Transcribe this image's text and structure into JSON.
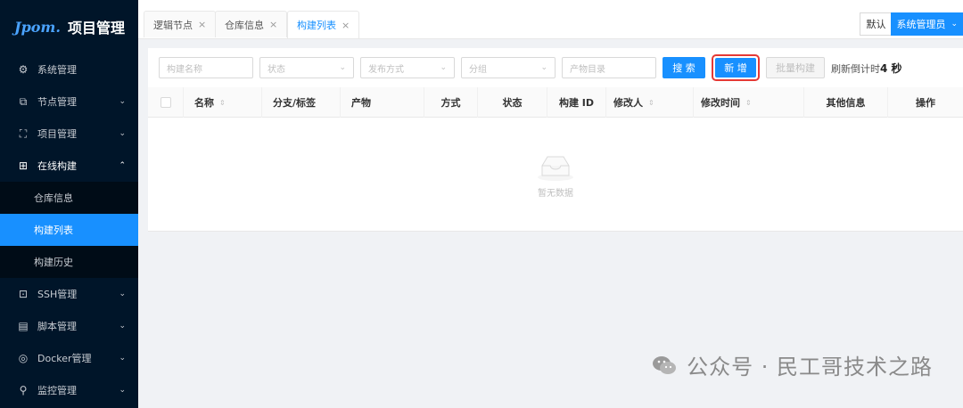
{
  "app": {
    "logo_mark": "Jpom.",
    "title": "项目管理"
  },
  "sidebar": {
    "items": [
      {
        "label": "系统管理",
        "icon": "gear-icon"
      },
      {
        "label": "节点管理",
        "icon": "node-icon"
      },
      {
        "label": "项目管理",
        "icon": "project-tree-icon"
      },
      {
        "label": "在线构建",
        "icon": "build-icon"
      },
      {
        "label": "SSH管理",
        "icon": "terminal-icon"
      },
      {
        "label": "脚本管理",
        "icon": "script-file-icon"
      },
      {
        "label": "Docker管理",
        "icon": "docker-icon"
      },
      {
        "label": "监控管理",
        "icon": "monitor-search-icon"
      }
    ],
    "build_submenu": [
      {
        "label": "仓库信息"
      },
      {
        "label": "构建列表"
      },
      {
        "label": "构建历史"
      }
    ]
  },
  "tabs": [
    {
      "label": "逻辑节点"
    },
    {
      "label": "仓库信息"
    },
    {
      "label": "构建列表"
    }
  ],
  "user": {
    "default_label": "默认",
    "name": "系统管理员"
  },
  "filters": {
    "build_name_placeholder": "构建名称",
    "status_placeholder": "状态",
    "release_method_placeholder": "发布方式",
    "group_placeholder": "分组",
    "artifact_dir_placeholder": "产物目录",
    "search_label": "搜 索",
    "add_label": "新 增",
    "batch_build_label": "批量构建",
    "refresh_prefix": "刷新倒计时",
    "refresh_count": "4 秒"
  },
  "table": {
    "columns": [
      "名称",
      "分支/标签",
      "产物",
      "方式",
      "状态",
      "构建 ID",
      "修改人",
      "修改时间",
      "其他信息",
      "操作"
    ],
    "empty_text": "暂无数据"
  },
  "watermark": {
    "text": "公众号 · 民工哥技术之路"
  },
  "colors": {
    "sidebar_bg": "#001529",
    "accent": "#1890ff",
    "highlight_border": "#e53935"
  }
}
